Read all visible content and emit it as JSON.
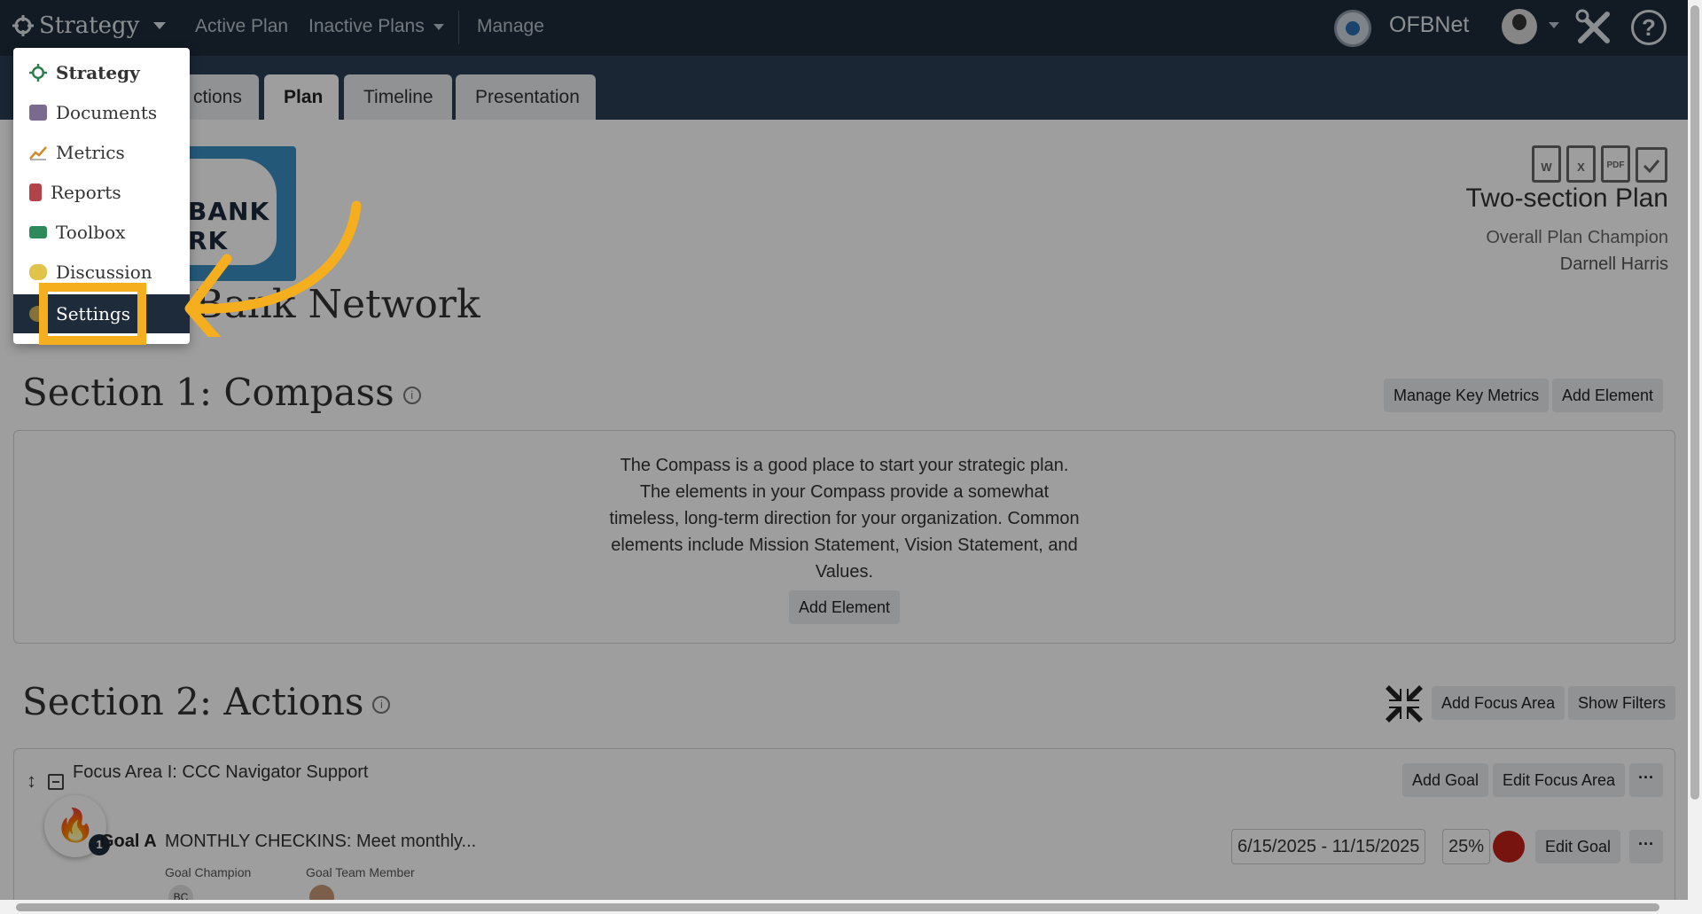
{
  "topnav": {
    "brand": "Strategy",
    "links": [
      "Active Plan",
      "Inactive Plans",
      "Manage"
    ],
    "org_name": "OFBNet"
  },
  "tabs": [
    "ctions",
    "Plan",
    "Timeline",
    "Presentation"
  ],
  "plan": {
    "logo_line1": "BANK",
    "logo_line2": "RK",
    "org_title": "Bank Network",
    "name": "Two-section Plan",
    "champion_label": "Overall Plan Champion",
    "champion_name": "Darnell Harris",
    "doc_icons": [
      "W",
      "X",
      "PDF"
    ]
  },
  "section1": {
    "title": "Section 1: Compass",
    "buttons": [
      "Manage Key Metrics",
      "Add Element"
    ],
    "description": "The Compass is a good place to start your strategic plan. The elements in your Compass provide a somewhat timeless, long-term direction for your organization. Common elements include Mission Statement, Vision Statement, and Values.",
    "add_button": "Add Element"
  },
  "section2": {
    "title": "Section 2: Actions",
    "buttons": [
      "Add Focus Area",
      "Show Filters"
    ],
    "focus_area": {
      "title": "Focus Area I: CCC Navigator Support",
      "buttons": [
        "Add Goal",
        "Edit Focus Area",
        "···"
      ]
    },
    "goal": {
      "label": "Goal A",
      "title": "MONTHLY CHECKINS: Meet monthly...",
      "dates": "6/15/2025 - 11/15/2025",
      "progress": "25%",
      "edit": "Edit Goal",
      "more": "···",
      "champion_label": "Goal Champion",
      "team_label": "Goal Team Member",
      "champion_initials": "BC",
      "fire_count": "1"
    }
  },
  "dropdown": {
    "items": [
      "Strategy",
      "Documents",
      "Metrics",
      "Reports",
      "Toolbox",
      "Discussion",
      "Settings"
    ]
  },
  "colors": {
    "nav": "#1e2b3b",
    "band": "#2a3e55",
    "highlight": "#f5ae1e",
    "status": "#c0211a"
  }
}
